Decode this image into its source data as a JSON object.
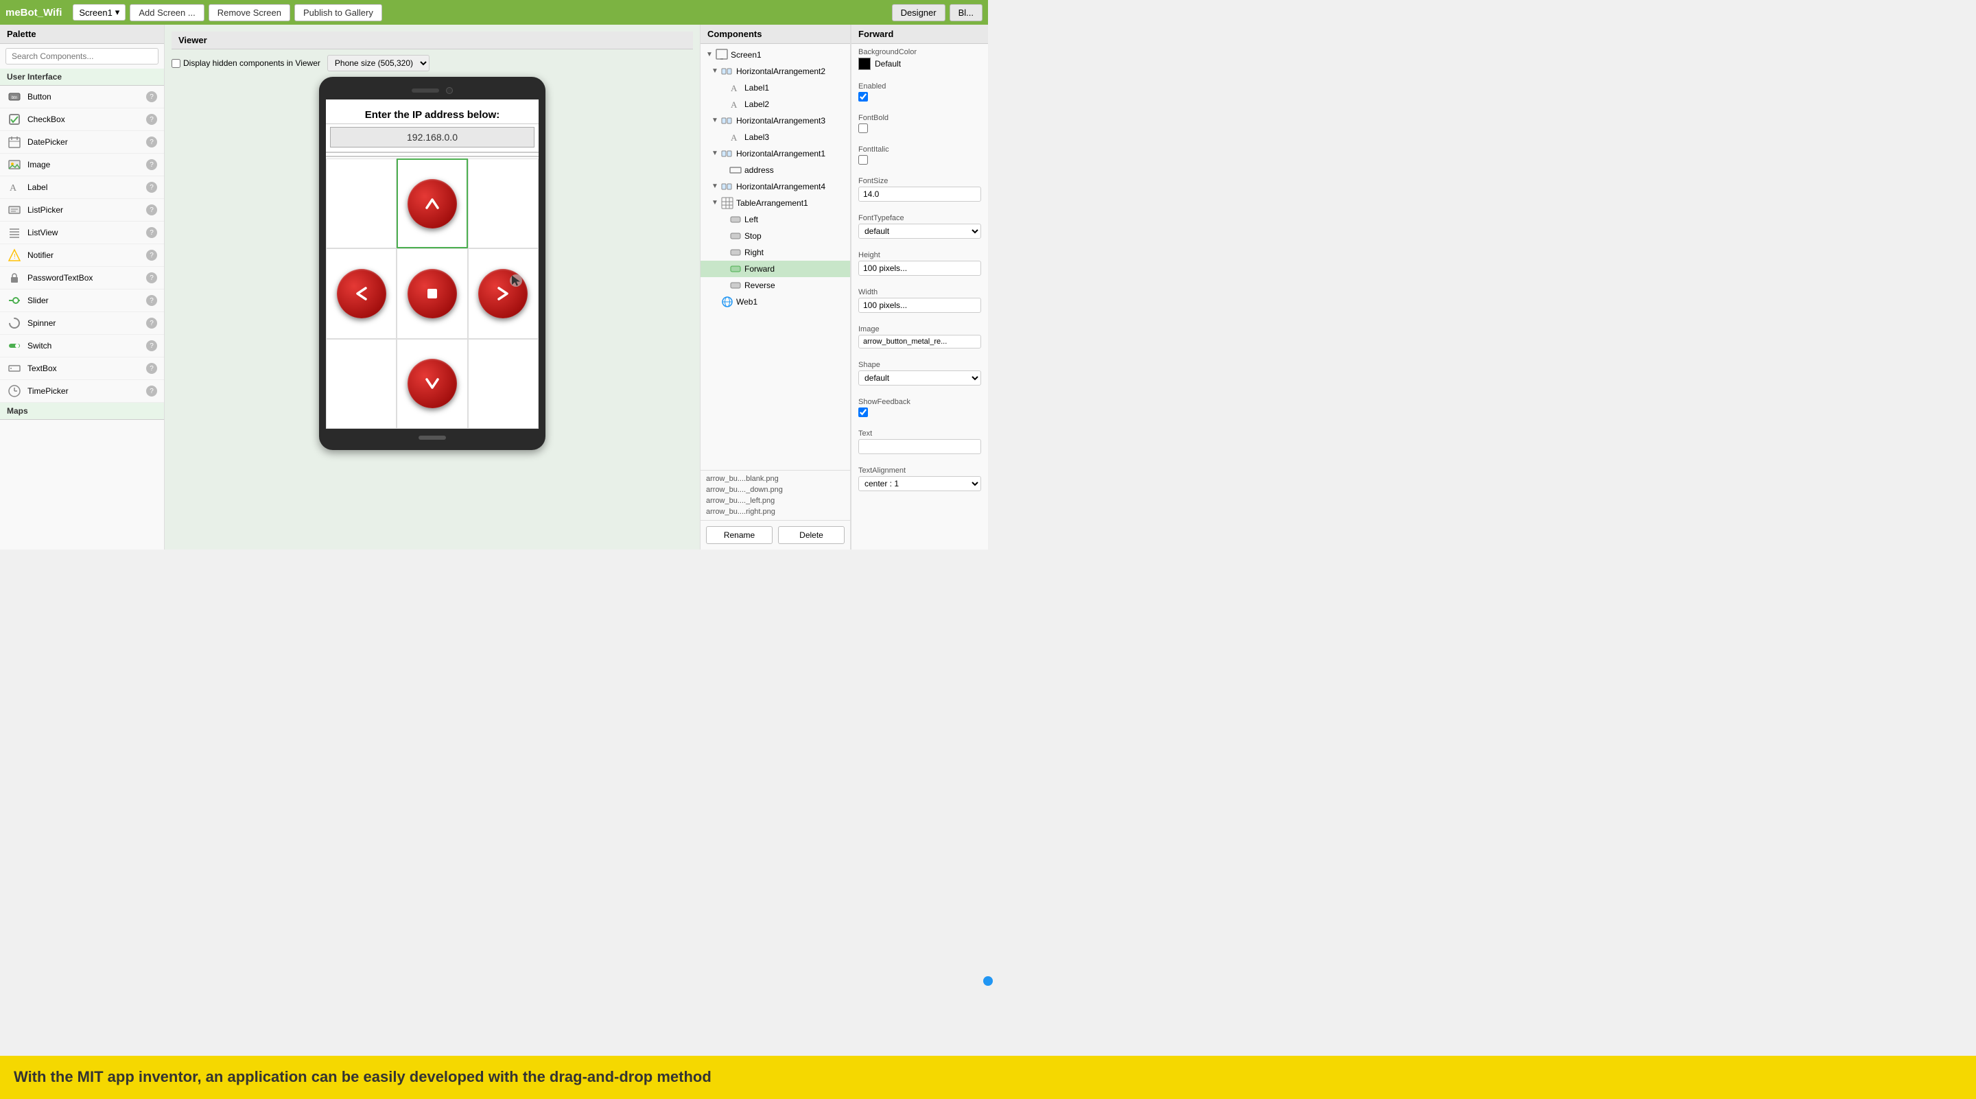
{
  "topbar": {
    "app_title": "meBot_Wifi",
    "screen_label": "Screen1",
    "dropdown_arrow": "▾",
    "add_screen_label": "Add Screen ...",
    "remove_screen_label": "Remove Screen",
    "publish_label": "Publish to Gallery",
    "designer_label": "Designer",
    "blocks_label": "Bl..."
  },
  "palette": {
    "header": "Palette",
    "search_placeholder": "Search Components...",
    "category_ui": "User Interface",
    "items": [
      {
        "label": "Button",
        "icon": "btn"
      },
      {
        "label": "CheckBox",
        "icon": "chk"
      },
      {
        "label": "DatePicker",
        "icon": "date"
      },
      {
        "label": "Image",
        "icon": "img"
      },
      {
        "label": "Label",
        "icon": "lbl"
      },
      {
        "label": "ListPicker",
        "icon": "list"
      },
      {
        "label": "ListView",
        "icon": "listv"
      },
      {
        "label": "Notifier",
        "icon": "notif"
      },
      {
        "label": "PasswordTextBox",
        "icon": "pwd"
      },
      {
        "label": "Slider",
        "icon": "slider"
      },
      {
        "label": "Spinner",
        "icon": "spin"
      },
      {
        "label": "Switch",
        "icon": "sw"
      },
      {
        "label": "TextBox",
        "icon": "tb"
      },
      {
        "label": "TimePicker",
        "icon": "time"
      }
    ],
    "maps_label": "Maps"
  },
  "viewer": {
    "header": "Viewer",
    "hidden_label": "Display hidden components in Viewer",
    "phone_size_label": "Phone size (505,320)",
    "ip_label": "Enter the IP address below:",
    "ip_value": "192.168.0.0"
  },
  "phone_buttons": {
    "forward_arrow": "▲",
    "left_arrow": "◀",
    "stop": "●",
    "right_arrow": "▶",
    "back_arrow": "▼"
  },
  "components": {
    "header": "Components",
    "tree": [
      {
        "label": "Screen1",
        "level": 0,
        "type": "screen"
      },
      {
        "label": "HorizontalArrangement2",
        "level": 1,
        "type": "horiz"
      },
      {
        "label": "Label1",
        "level": 2,
        "type": "label"
      },
      {
        "label": "Label2",
        "level": 2,
        "type": "label"
      },
      {
        "label": "HorizontalArrangement3",
        "level": 1,
        "type": "horiz"
      },
      {
        "label": "Label3",
        "level": 2,
        "type": "label"
      },
      {
        "label": "HorizontalArrangement1",
        "level": 1,
        "type": "horiz"
      },
      {
        "label": "address",
        "level": 2,
        "type": "tb"
      },
      {
        "label": "HorizontalArrangement4",
        "level": 1,
        "type": "horiz"
      },
      {
        "label": "TableArrangement1",
        "level": 1,
        "type": "table"
      },
      {
        "label": "Left",
        "level": 2,
        "type": "btn"
      },
      {
        "label": "Stop",
        "level": 2,
        "type": "btn"
      },
      {
        "label": "Right",
        "level": 2,
        "type": "btn"
      },
      {
        "label": "Forward",
        "level": 2,
        "type": "btn",
        "selected": true
      },
      {
        "label": "Reverse",
        "level": 2,
        "type": "btn"
      },
      {
        "label": "Web1",
        "level": 1,
        "type": "web"
      }
    ],
    "rename_label": "Rename",
    "delete_label": "Delete",
    "media_items": [
      "arrow_bu....blank.png",
      "arrow_bu...._down.png",
      "arrow_bu...._left.png",
      "arrow_bu....right.png"
    ]
  },
  "properties": {
    "header": "Forward",
    "bg_color_label": "BackgroundColor",
    "bg_color_value": "Default",
    "enabled_label": "Enabled",
    "enabled_checked": true,
    "fontbold_label": "FontBold",
    "fontbold_checked": false,
    "fontitalic_label": "FontItalic",
    "fontitalic_checked": false,
    "fontsize_label": "FontSize",
    "fontsize_value": "14.0",
    "fonttypeface_label": "FontTypeface",
    "fonttypeface_value": "default",
    "height_label": "Height",
    "height_value": "100 pixels...",
    "width_label": "Width",
    "width_value": "100 pixels...",
    "image_label": "Image",
    "image_value": "arrow_button_metal_re...",
    "shape_label": "Shape",
    "shape_value": "default",
    "showfeedback_label": "ShowFeedback",
    "showfeedback_checked": true,
    "text_label": "Text",
    "text_value": "",
    "textalignment_label": "TextAlignment",
    "textalignment_value": "center : 1"
  },
  "yellow_bar": {
    "text": "With the MIT app inventor, an application can be easily developed with the drag-and-drop method"
  }
}
